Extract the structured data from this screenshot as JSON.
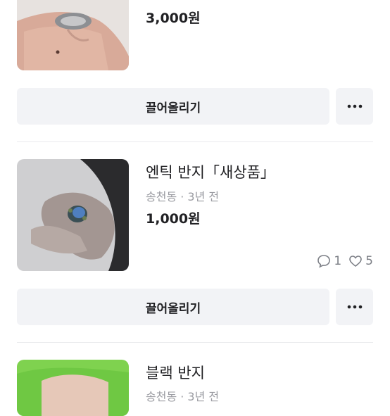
{
  "items": [
    {
      "title": "",
      "meta": "",
      "price": "3,000원",
      "bump_label": "끌어올리기",
      "more_label": "•••"
    },
    {
      "title": "엔틱 반지「새상품」",
      "meta": "송천동 · 3년 전",
      "price": "1,000원",
      "chat_count": "1",
      "like_count": "5",
      "bump_label": "끌어올리기",
      "more_label": "•••"
    },
    {
      "title": "블랙 반지",
      "meta": "송천동 · 3년 전"
    }
  ],
  "icons": {
    "chat": "chat-bubble-icon",
    "like": "heart-outline-icon",
    "more": "more-horizontal-icon"
  }
}
